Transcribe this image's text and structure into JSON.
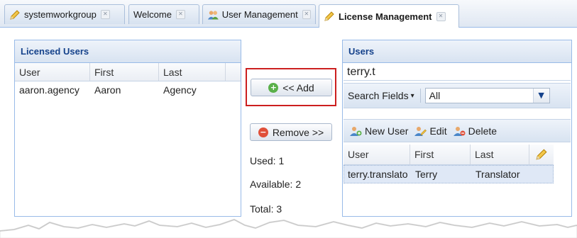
{
  "tabs": [
    {
      "label": "systemworkgroup",
      "icon": "pencil-icon",
      "active": false
    },
    {
      "label": "Welcome",
      "icon": "",
      "active": false
    },
    {
      "label": "User Management",
      "icon": "users-icon",
      "active": false
    },
    {
      "label": "License Management",
      "icon": "pencil-icon",
      "active": true
    }
  ],
  "licensed_users": {
    "title": "Licensed Users",
    "columns": [
      "User",
      "First",
      "Last"
    ],
    "rows": [
      {
        "user": "aaron.agency",
        "first": "Aaron",
        "last": "Agency"
      }
    ]
  },
  "actions": {
    "add_label": "<< Add",
    "remove_label": "Remove >>"
  },
  "stats": {
    "used": "Used: 1",
    "available": "Available: 2",
    "total": "Total: 3"
  },
  "users": {
    "title": "Users",
    "search_value": "terry.t",
    "search_fields_label": "Search Fields",
    "search_fields_value": "All",
    "toolbar": {
      "new_user": "New User",
      "edit": "Edit",
      "delete": "Delete"
    },
    "columns": [
      "User",
      "First",
      "Last"
    ],
    "rows": [
      {
        "user": "terry.translato",
        "first": "Terry",
        "last": "Translator"
      }
    ]
  },
  "colors": {
    "highlight": "#cc1f1f",
    "header_text": "#15428b",
    "selected_row": "#dfe8f6"
  }
}
